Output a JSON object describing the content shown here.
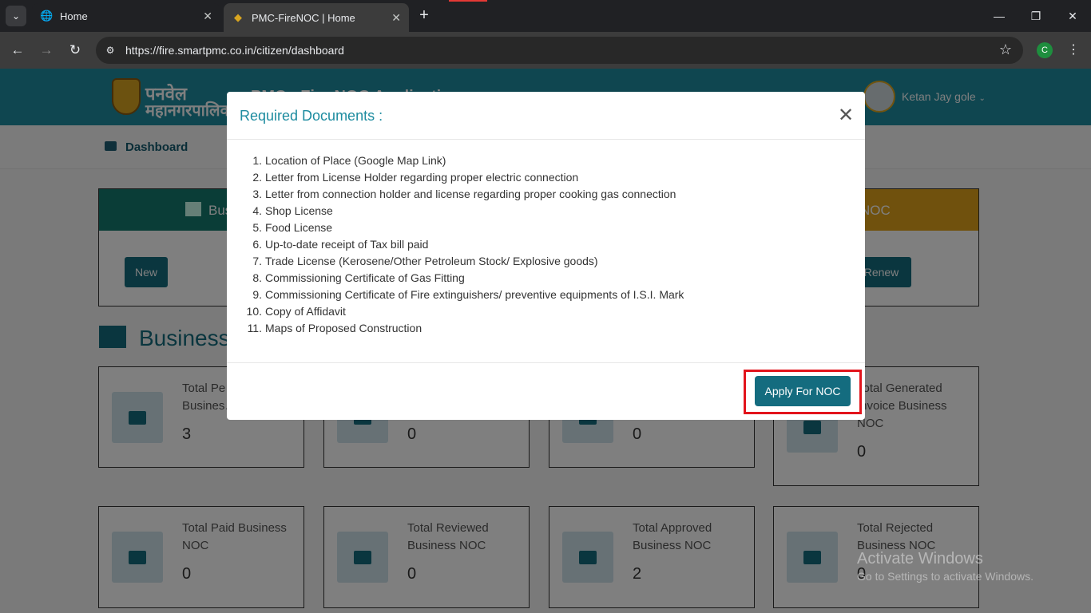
{
  "browser": {
    "tabs": [
      {
        "label": "Home",
        "icon": "globe-icon"
      },
      {
        "label": "PMC-FireNOC | Home",
        "icon": "pmc-emblem-icon"
      }
    ],
    "url": "https://fire.smartpmc.co.in/citizen/dashboard",
    "profile_initial": "C"
  },
  "header": {
    "logo_line1": "पनवेल",
    "logo_line2": "महानगरपालिका",
    "app_title": "PMC - Fire NOC Application",
    "user_name": "Ketan Jay gole"
  },
  "subnav": {
    "dashboard": "Dashboard"
  },
  "cards": {
    "business": {
      "title": "Bus",
      "button": "New",
      "color": "#157a6e"
    },
    "renew": {
      "title": "NOC",
      "button": "Renew",
      "color": "#e0a21a"
    }
  },
  "section": {
    "title": "Business"
  },
  "stats_row1": [
    {
      "label": "Total Pe… Busines…",
      "value": "3"
    },
    {
      "label": "",
      "value": "0"
    },
    {
      "label": "",
      "value": "0"
    },
    {
      "label": "Total Generated Invoice Business NOC",
      "value": "0"
    }
  ],
  "stats_row2": [
    {
      "label": "Total Paid Business NOC",
      "value": "0"
    },
    {
      "label": "Total Reviewed Business NOC",
      "value": "0"
    },
    {
      "label": "Total Approved Business NOC",
      "value": "2"
    },
    {
      "label": "Total Rejected Business NOC",
      "value": "0"
    }
  ],
  "modal": {
    "title": "Required Documents :",
    "items": [
      "Location of Place (Google Map Link)",
      "Letter from License Holder regarding proper electric connection",
      "Letter from connection holder and license regarding proper cooking gas connection",
      "Shop License",
      "Food License",
      "Up-to-date receipt of Tax bill paid",
      "Trade License (Kerosene/Other Petroleum Stock/ Explosive goods)",
      "Commissioning Certificate of Gas Fitting",
      "Commissioning Certificate of Fire extinguishers/ preventive equipments of I.S.I. Mark",
      "Copy of Affidavit",
      "Maps of Proposed Construction"
    ],
    "apply_button": "Apply For NOC"
  },
  "watermark": {
    "line1": "Activate Windows",
    "line2": "Go to Settings to activate Windows."
  }
}
